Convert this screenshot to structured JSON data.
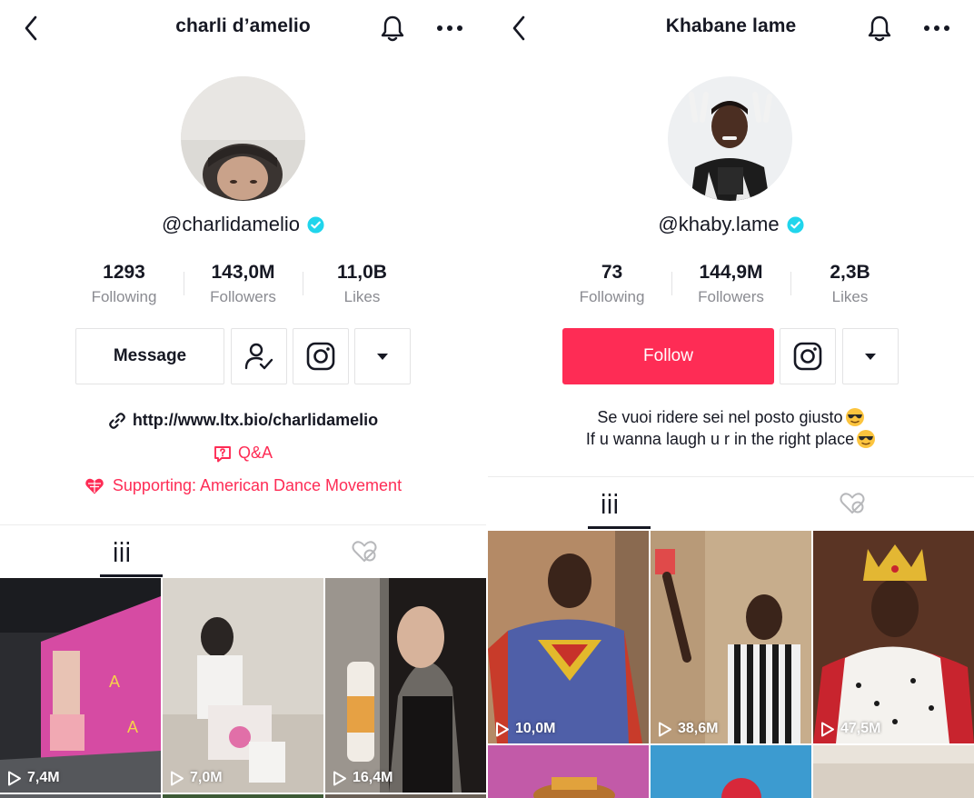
{
  "left_profile": {
    "header": {
      "title": "charli d’amelio"
    },
    "handle": "@charlidamelio",
    "stats": [
      {
        "value": "1293",
        "label": "Following"
      },
      {
        "value": "143,0M",
        "label": "Followers"
      },
      {
        "value": "11,0B",
        "label": "Likes"
      }
    ],
    "buttons": {
      "message_label": "Message"
    },
    "link": "http://www.ltx.bio/charlidamelio",
    "qa_label": "Q&A",
    "supporting": "Supporting: American Dance Movement",
    "videos": [
      {
        "views": "7,4M"
      },
      {
        "views": "7,0M"
      },
      {
        "views": "16,4M"
      }
    ]
  },
  "right_profile": {
    "header": {
      "title": "Khabane lame"
    },
    "handle": "@khaby.lame",
    "stats": [
      {
        "value": "73",
        "label": "Following"
      },
      {
        "value": "144,9M",
        "label": "Followers"
      },
      {
        "value": "2,3B",
        "label": "Likes"
      }
    ],
    "buttons": {
      "follow_label": "Follow"
    },
    "bio": [
      "Se vuoi ridere sei nel posto giusto",
      "If u wanna laugh u r in the right place"
    ],
    "videos": [
      {
        "views": "10,0M"
      },
      {
        "views": "38,6M"
      },
      {
        "views": "47,5M"
      }
    ]
  },
  "icons": [
    "back-icon",
    "bell-icon",
    "more-icon",
    "verified-icon",
    "add-friend-icon",
    "instagram-icon",
    "dropdown-icon",
    "link-icon",
    "qa-icon",
    "charity-icon",
    "grid-icon",
    "liked-icon",
    "play-icon",
    "sunglasses-emoji-icon"
  ],
  "colors": {
    "accent": "#fe2c55",
    "verified": "#20d5ec",
    "text": "#161823",
    "secondary": "#8a8b91"
  }
}
